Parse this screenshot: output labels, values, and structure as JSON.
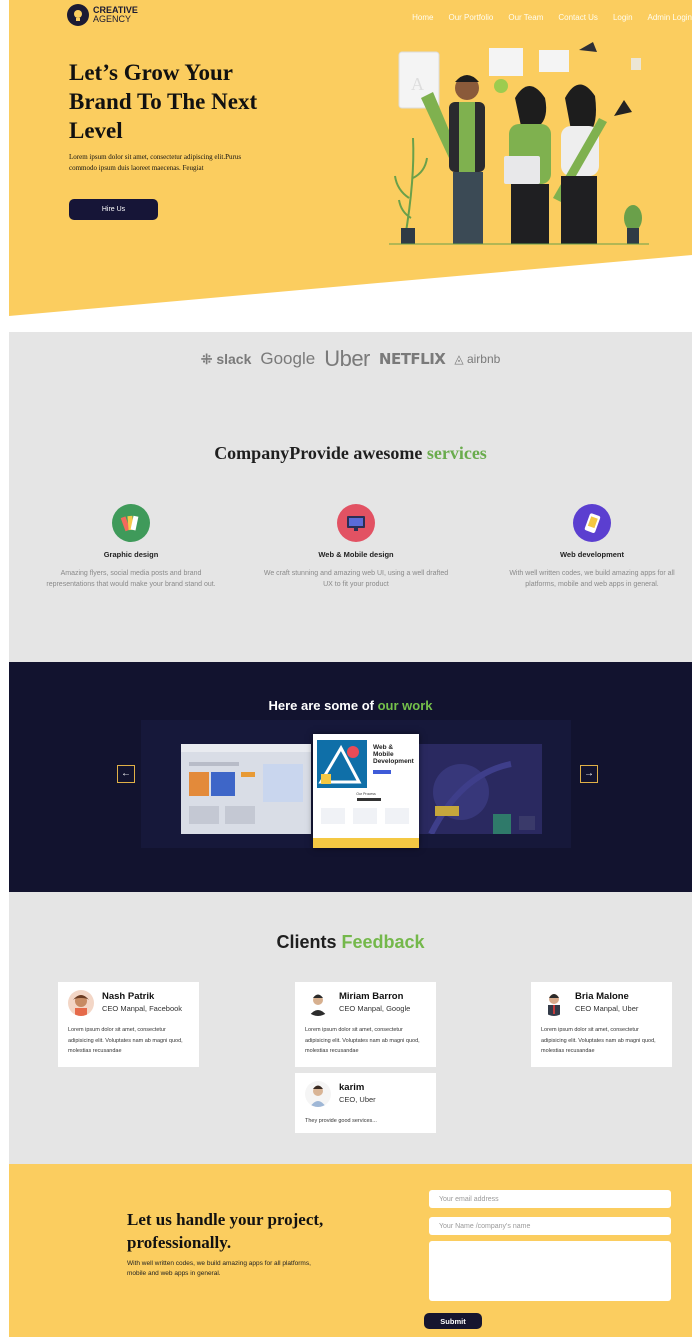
{
  "brand": {
    "name": "CREATIVE",
    "sub": "AGENCY"
  },
  "nav": [
    "Home",
    "Our Portfolio",
    "Our Team",
    "Contact Us",
    "Login",
    "Admin Login"
  ],
  "hero": {
    "title": "Let’s Grow Your Brand To The Next Level",
    "description": "Lorem ipsum dolor sit amet, consectetur adipiscing elit.Purus commodo ipsum duis laoreet maecenas. Feugiat",
    "button": "Hire Us"
  },
  "partners": [
    "slack",
    "Google",
    "Uber",
    "NETFLIX",
    "airbnb"
  ],
  "services": {
    "heading_main": "CompanyProvide awesome ",
    "heading_accent": "services",
    "items": [
      {
        "title": "Graphic design",
        "description": "Amazing flyers, social media posts and brand representations that would make your brand stand out.",
        "icon": "palette-icon"
      },
      {
        "title": "Web & Mobile design",
        "description": "We craft stunning and amazing web UI, using a well drafted UX to fit your product",
        "icon": "monitor-icon"
      },
      {
        "title": "Web development",
        "description": "With well written codes, we build amazing apps for all platforms, mobile and web apps in general.",
        "icon": "phone-code-icon"
      }
    ]
  },
  "work": {
    "heading_main": "Here are some of ",
    "heading_accent": "our work",
    "slide_title": "Web & Mobile Development",
    "slide_section": "Our Process",
    "prev": "←",
    "next": "→"
  },
  "feedback": {
    "heading_main": "Clients ",
    "heading_accent": "Feedback",
    "cards": [
      {
        "name": "Nash Patrik",
        "role": "CEO Manpal, Facebook",
        "text": "Lorem ipsum dolor sit amet, consectetur adipisicing elit. Voluptates nam ab magni quod, molestias recusandae"
      },
      {
        "name": "Miriam Barron",
        "role": "CEO Manpal, Google",
        "text": "Lorem ipsum dolor sit amet, consectetur adipisicing elit. Voluptates nam ab magni quod, molestias recusandae"
      },
      {
        "name": "Bria Malone",
        "role": "CEO Manpal, Uber",
        "text": "Lorem ipsum dolor sit amet, consectetur adipisicing elit. Voluptates nam ab magni quod, molestias recusandae"
      },
      {
        "name": "karim",
        "role": "CEO, Uber",
        "text": "They provide good services..."
      }
    ]
  },
  "contact": {
    "title": "Let us handle your project, professionally.",
    "description": "With well written codes, we build amazing apps for all platforms, mobile and web apps in general.",
    "email_placeholder": "Your email address",
    "name_placeholder": "Your Name /company's name",
    "submit": "Submit"
  },
  "colors": {
    "yellow": "#fbcd5f",
    "navy": "#12132f",
    "green": "#6aac4d",
    "gray": "#e5e5e5"
  }
}
